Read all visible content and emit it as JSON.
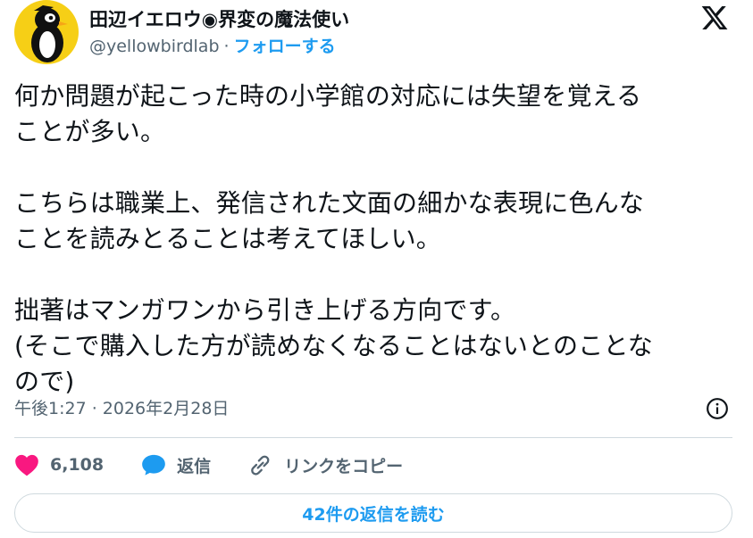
{
  "author": {
    "display_name": "田辺イエロウ◉界変の魔法使い",
    "handle": "@yellowbirdlab",
    "separator": "·",
    "follow_label": "フォローする",
    "avatar_color": "#f6cf16"
  },
  "tweet": {
    "text": "何か問題が起こった時の小学館の対応には失望を覚える\nことが多い。\n\nこちらは職業上、発信された文面の細かな表現に色んな\nことを読みとることは考えてほしい。\n\n拙著はマンガワンから引き上げる方向です。\n(そこで購入した方が読めなくなることはないとのことな\nので)",
    "timestamp": "午後1:27 · 2026年2月28日"
  },
  "actions": {
    "likes": "6,108",
    "reply_label": "返信",
    "copy_link_label": "リンクをコピー"
  },
  "footer": {
    "read_replies_label": "42件の返信を読む"
  },
  "icons": {
    "brand": "x-logo-icon",
    "info": "info-icon",
    "like": "heart-icon",
    "reply": "speech-bubble-icon",
    "link": "link-icon"
  },
  "colors": {
    "accent": "#1d9bf0",
    "like": "#f91880",
    "muted": "#536471",
    "text": "#0f1419"
  }
}
